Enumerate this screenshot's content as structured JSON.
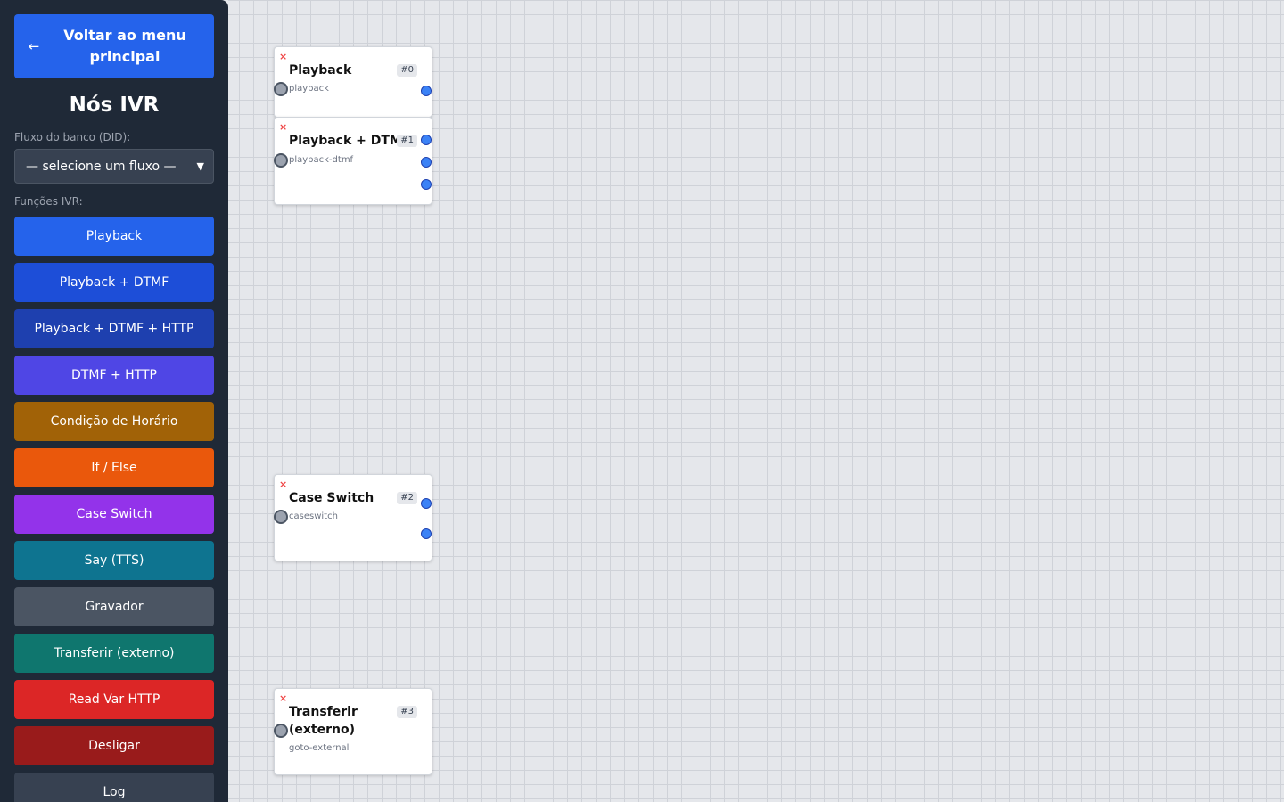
{
  "sidebar": {
    "back_button": {
      "icon": "arrow-left-icon",
      "label": "Voltar ao menu principal"
    },
    "title": "Nós IVR",
    "flow_label": "Fluxo do banco (DID):",
    "flow_select": {
      "value": "— selecione um fluxo —"
    },
    "functions_label": "Funções IVR:",
    "functions": [
      {
        "label": "Playback",
        "color": "#2563eb"
      },
      {
        "label": "Playback + DTMF",
        "color": "#1d4ed8"
      },
      {
        "label": "Playback + DTMF + HTTP",
        "color": "#1e40af"
      },
      {
        "label": "DTMF + HTTP",
        "color": "#4f46e5"
      },
      {
        "label": "Condição de Horário",
        "color": "#a16207"
      },
      {
        "label": "If / Else",
        "color": "#ea580c"
      },
      {
        "label": "Case Switch",
        "color": "#9333ea"
      },
      {
        "label": "Say (TTS)",
        "color": "#0e7490"
      },
      {
        "label": "Gravador",
        "color": "#4b5563"
      },
      {
        "label": "Transferir (externo)",
        "color": "#0f766e"
      },
      {
        "label": "Read Var HTTP",
        "color": "#dc2626"
      },
      {
        "label": "Desligar",
        "color": "#991b1b"
      },
      {
        "label": "Log",
        "color": "#374151"
      }
    ]
  },
  "canvas": {
    "nodes": [
      {
        "title": "Playback",
        "id": "#0",
        "type": "playback",
        "delete": "×"
      },
      {
        "title": "Playback + DTMF",
        "id": "#1",
        "type": "playback-dtmf",
        "delete": "×"
      },
      {
        "title": "Case Switch",
        "id": "#2",
        "type": "caseswitch",
        "delete": "×"
      },
      {
        "title": "Transferir (externo)",
        "id": "#3",
        "type": "goto-external",
        "delete": "×"
      }
    ]
  }
}
